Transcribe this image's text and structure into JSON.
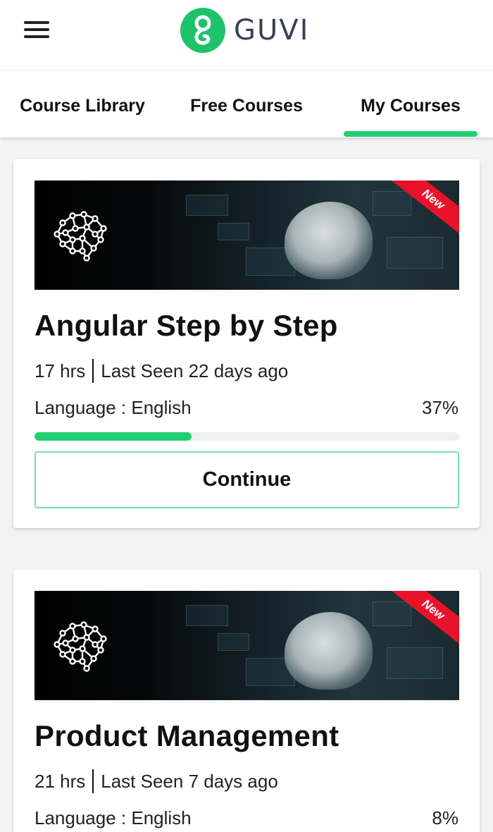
{
  "header": {
    "menu_icon": "hamburger-menu-icon",
    "logo_icon": "guvi-logo-icon",
    "logo_text": "GUVI",
    "accent_color": "#21cf72"
  },
  "tabs": [
    {
      "label": "Course Library",
      "active": false
    },
    {
      "label": "Free Courses",
      "active": false
    },
    {
      "label": "My Courses",
      "active": true
    }
  ],
  "courses": [
    {
      "title": "Angular Step by Step",
      "duration": "17 hrs",
      "last_seen": "Last Seen 22 days ago",
      "language": "Language : English",
      "progress_text": "37%",
      "progress": 0.37,
      "badge": "New",
      "button_label": "Continue",
      "banner_icon": "neural-network-brain-icon"
    },
    {
      "title": "Product Management",
      "duration": "21 hrs",
      "last_seen": "Last Seen 7 days ago",
      "language": "Language : English",
      "progress_text": "8%",
      "progress": 0.08,
      "badge": "New",
      "banner_icon": "neural-network-brain-icon"
    }
  ]
}
